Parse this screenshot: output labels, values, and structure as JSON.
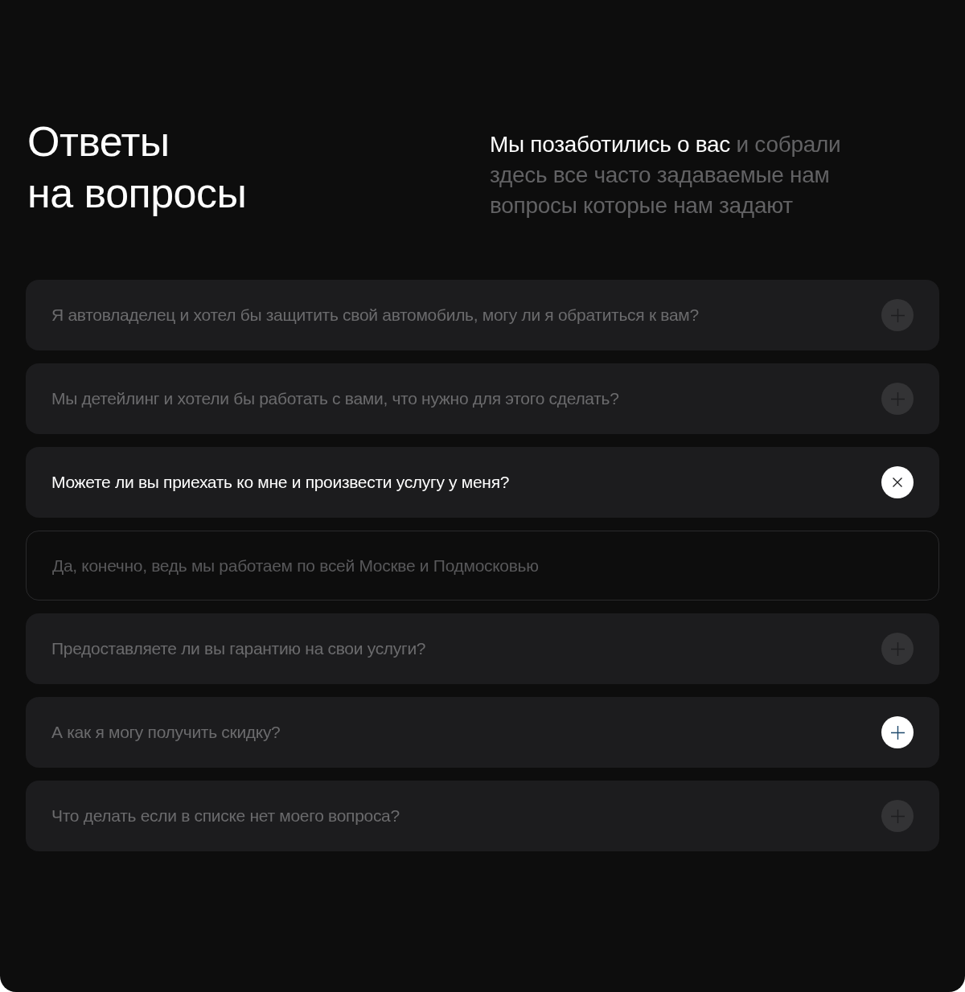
{
  "heading": {
    "lines": [
      "Ответы",
      "на вопросы"
    ]
  },
  "intro": {
    "lead": "Мы позаботились о вас",
    "rest": "и собрали здесь все часто задаваемые нам вопросы которые нам задают"
  },
  "faq": [
    {
      "question": "Я автовладелец и хотел бы защитить свой автомобиль, могу ли я обратиться к вам?",
      "expanded": false,
      "hovered": false
    },
    {
      "question": "Мы детейлинг и хотели бы работать с вами, что нужно для этого сделать?",
      "expanded": false,
      "hovered": false
    },
    {
      "question": "Можете ли вы приехать ко мне и произвести услугу у меня?",
      "expanded": true,
      "hovered": false,
      "answer": "Да, конечно, ведь мы работаем по всей Москве и Подмосковью"
    },
    {
      "question": "Предоставляете ли вы гарантию на свои услуги?",
      "expanded": false,
      "hovered": false
    },
    {
      "question": "А как я могу получить скидку?",
      "expanded": false,
      "hovered": true
    },
    {
      "question": "Что делать если в списке нет моего вопроса?",
      "expanded": false,
      "hovered": false
    }
  ]
}
